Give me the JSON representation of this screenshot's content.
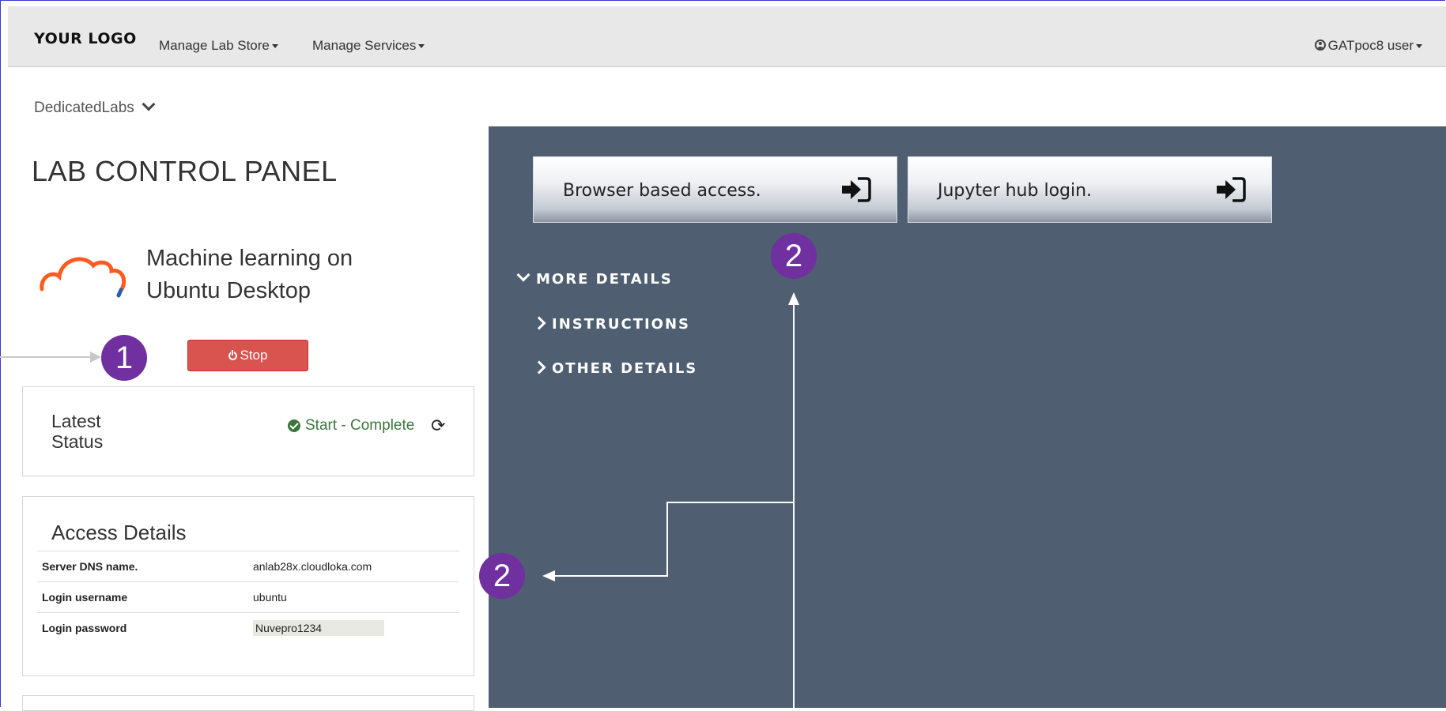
{
  "header": {
    "logo": "YOUR LOGO",
    "nav": [
      {
        "label": "Manage Lab Store"
      },
      {
        "label": "Manage Services"
      }
    ],
    "user": "GATpoc8 user"
  },
  "breadcrumb": {
    "label": "DedicatedLabs"
  },
  "page": {
    "title": "LAB CONTROL PANEL",
    "lab_name_line1": "Machine learning on",
    "lab_name_line2": "Ubuntu Desktop",
    "stop_label": "Stop"
  },
  "latest_status": {
    "label": "Latest Status",
    "value": "Start - Complete"
  },
  "access_details": {
    "title": "Access Details",
    "rows": [
      {
        "label": "Server DNS name.",
        "value": "anlab28x.cloudloka.com"
      },
      {
        "label": "Login username",
        "value": "ubuntu"
      },
      {
        "label": "Login password",
        "value": "Nuvepro1234"
      }
    ]
  },
  "access_buttons": [
    {
      "label": "Browser based access."
    },
    {
      "label": "Jupyter hub login."
    }
  ],
  "details_sections": {
    "more": "MORE DETAILS",
    "instructions": "INSTRUCTIONS",
    "other": "OTHER DETAILS"
  },
  "annotations": {
    "badge1": "1",
    "badge2a": "2",
    "badge2b": "2",
    "badge_color": "#7030a0"
  },
  "colors": {
    "topbar": "#e8e8e8",
    "panel": "#4f5f71",
    "stop": "#d9534f",
    "status_ok": "#3c763d"
  }
}
